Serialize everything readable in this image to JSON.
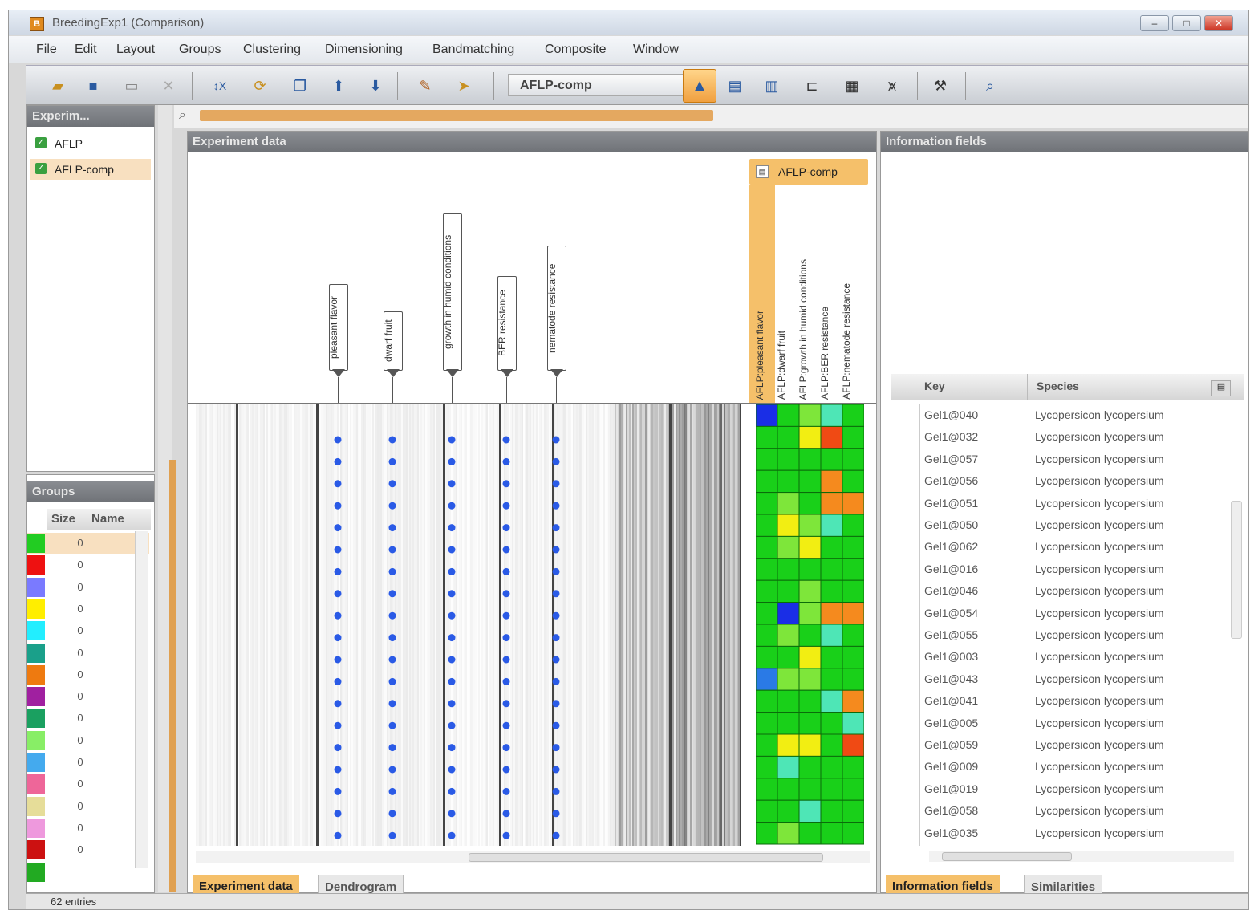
{
  "window": {
    "title": "BreedingExp1 (Comparison)"
  },
  "menu": [
    "File",
    "Edit",
    "Layout",
    "Groups",
    "Clustering",
    "Dimensioning",
    "Bandmatching",
    "Composite",
    "Window"
  ],
  "toolbar": {
    "combo_value": "AFLP-comp"
  },
  "experiments": {
    "title": "Experim...",
    "items": [
      {
        "label": "AFLP",
        "selected": false
      },
      {
        "label": "AFLP-comp",
        "selected": true
      }
    ]
  },
  "groups": {
    "title": "Groups",
    "header_size": "Size",
    "header_name": "Name",
    "rows": [
      {
        "color": "#22cc22",
        "size": "0"
      },
      {
        "color": "#ee1111",
        "size": "0"
      },
      {
        "color": "#7a7aff",
        "size": "0"
      },
      {
        "color": "#ffee00",
        "size": "0"
      },
      {
        "color": "#22eeff",
        "size": "0"
      },
      {
        "color": "#1aa08a",
        "size": "0"
      },
      {
        "color": "#ee7a10",
        "size": "0"
      },
      {
        "color": "#a020a0",
        "size": "0"
      },
      {
        "color": "#1aa060",
        "size": "0"
      },
      {
        "color": "#88ee66",
        "size": "0"
      },
      {
        "color": "#44aaee",
        "size": "0"
      },
      {
        "color": "#ee6699",
        "size": "0"
      },
      {
        "color": "#e6dd99",
        "size": "0"
      },
      {
        "color": "#ee99dd",
        "size": "0"
      },
      {
        "color": "#cc1111",
        "size": "0"
      },
      {
        "color": "#22aa22",
        "size": ""
      }
    ]
  },
  "experiment_data": {
    "title": "Experiment data",
    "markers": [
      {
        "label": "pleasant flavor"
      },
      {
        "label": "dwarf fruit"
      },
      {
        "label": "growth in humid conditions"
      },
      {
        "label": "BER resistance"
      },
      {
        "label": "nematode resistance"
      }
    ],
    "composite": {
      "title": "AFLP-comp",
      "columns": [
        "AFLP:pleasant flavor",
        "AFLP:dwarf fruit",
        "AFLP:growth in humid conditions",
        "AFLP:BER resistance",
        "AFLP:nematode resistance"
      ]
    },
    "tabs": [
      {
        "label": "Experiment data",
        "active": true
      },
      {
        "label": "Dendrogram",
        "active": false
      }
    ]
  },
  "information_fields": {
    "title": "Information fields",
    "columns": {
      "key": "Key",
      "species": "Species"
    },
    "rows": [
      {
        "key": "Gel1@040",
        "species": "Lycopersicon lycopersium"
      },
      {
        "key": "Gel1@032",
        "species": "Lycopersicon lycopersium"
      },
      {
        "key": "Gel1@057",
        "species": "Lycopersicon lycopersium"
      },
      {
        "key": "Gel1@056",
        "species": "Lycopersicon lycopersium"
      },
      {
        "key": "Gel1@051",
        "species": "Lycopersicon lycopersium"
      },
      {
        "key": "Gel1@050",
        "species": "Lycopersicon lycopersium"
      },
      {
        "key": "Gel1@062",
        "species": "Lycopersicon lycopersium"
      },
      {
        "key": "Gel1@016",
        "species": "Lycopersicon lycopersium"
      },
      {
        "key": "Gel1@046",
        "species": "Lycopersicon lycopersium"
      },
      {
        "key": "Gel1@054",
        "species": "Lycopersicon lycopersium"
      },
      {
        "key": "Gel1@055",
        "species": "Lycopersicon lycopersium"
      },
      {
        "key": "Gel1@003",
        "species": "Lycopersicon lycopersium"
      },
      {
        "key": "Gel1@043",
        "species": "Lycopersicon lycopersium"
      },
      {
        "key": "Gel1@041",
        "species": "Lycopersicon lycopersium"
      },
      {
        "key": "Gel1@005",
        "species": "Lycopersicon lycopersium"
      },
      {
        "key": "Gel1@059",
        "species": "Lycopersicon lycopersium"
      },
      {
        "key": "Gel1@009",
        "species": "Lycopersicon lycopersium"
      },
      {
        "key": "Gel1@019",
        "species": "Lycopersicon lycopersium"
      },
      {
        "key": "Gel1@058",
        "species": "Lycopersicon lycopersium"
      },
      {
        "key": "Gel1@035",
        "species": "Lycopersicon lycopersium"
      }
    ],
    "tabs": [
      {
        "label": "Information fields",
        "active": true
      },
      {
        "label": "Similarities",
        "active": false
      }
    ]
  },
  "status": {
    "text": "62 entries"
  },
  "heatmap": {
    "colors": {
      "G": "#19d019",
      "L": "#7ee63a",
      "Y": "#f2ee12",
      "O": "#f58a1e",
      "R": "#f04a14",
      "C": "#4ee6b6",
      "B": "#1a2ee6",
      "S": "#2a7ae6"
    },
    "rows": [
      "BGLCG",
      "GGYRG",
      "GGGGG",
      "GGGOG",
      "GLGOO",
      "GYLCG",
      "GLYGG",
      "GGGGG",
      "GGLGG",
      "GBLOO",
      "GLGCG",
      "GGYGG",
      "SLLGG",
      "GGGCO",
      "GGGGC",
      "GYYGR",
      "GCGGG",
      "GGGGG",
      "GGCGG",
      "GLGGG"
    ]
  }
}
